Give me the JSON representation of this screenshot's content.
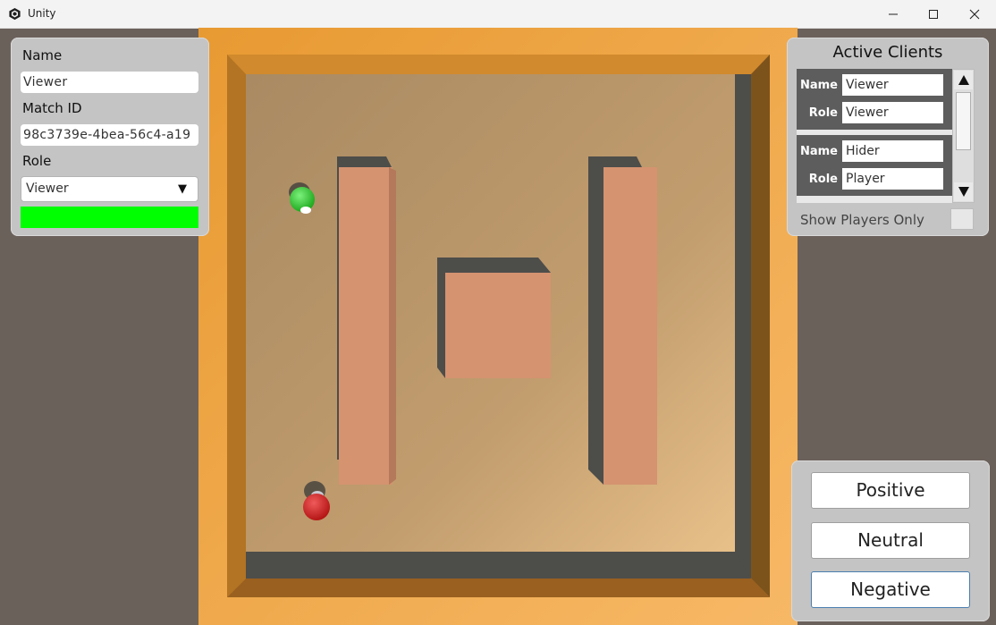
{
  "window": {
    "title": "Unity",
    "icon": "unity-logo-icon",
    "controls": [
      "minimize-icon",
      "maximize-icon",
      "close-icon"
    ]
  },
  "player_panel": {
    "name_label": "Name",
    "name_value": "Viewer",
    "match_label": "Match ID",
    "match_value": "98c3739e-4bea-56c4-a19",
    "role_label": "Role",
    "role_value": "Viewer",
    "role_dropdown_icon": "triangle-down-icon",
    "status_color": "#00ff00"
  },
  "clients_panel": {
    "title": "Active Clients",
    "clients": [
      {
        "name_label": "Name",
        "name": "Viewer",
        "role_label": "Role",
        "role": "Viewer"
      },
      {
        "name_label": "Name",
        "name": "Hider",
        "role_label": "Role",
        "role": "Player"
      }
    ],
    "show_players_label": "Show Players Only",
    "show_players_checked": false,
    "scroll_up_icon": "triangle-up-icon",
    "scroll_down_icon": "triangle-down-icon"
  },
  "feedback_panel": {
    "buttons": [
      {
        "label": "Positive",
        "selected": false
      },
      {
        "label": "Neutral",
        "selected": false
      },
      {
        "label": "Negative",
        "selected": true
      }
    ]
  },
  "scene": {
    "players": [
      {
        "color": "#22c322",
        "kind": "green-player"
      },
      {
        "color": "#d41c1c",
        "kind": "red-player"
      }
    ],
    "colors": {
      "border": "#eb9f36",
      "floor": "#c9a06d",
      "wall": "#d49170",
      "shadow": "#4d4d4a"
    }
  }
}
